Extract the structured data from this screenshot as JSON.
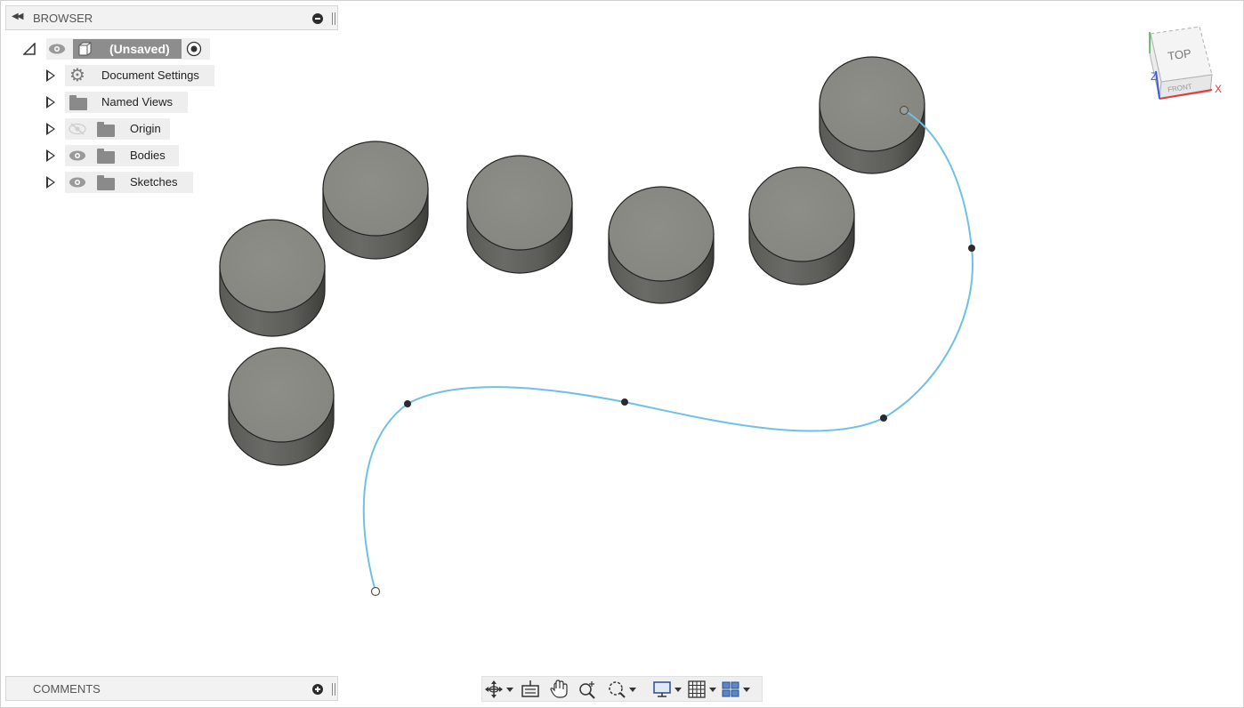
{
  "browser": {
    "title": "BROWSER",
    "root_label": "(Unsaved)",
    "items": [
      {
        "label": "Document Settings",
        "icon": "gear-icon"
      },
      {
        "label": "Named Views",
        "icon": "folder-icon"
      },
      {
        "label": "Origin",
        "icon": "folder-icon",
        "visibility": "hidden"
      },
      {
        "label": "Bodies",
        "icon": "folder-icon",
        "visibility": "visible"
      },
      {
        "label": "Sketches",
        "icon": "folder-icon",
        "visibility": "visible"
      }
    ]
  },
  "comments": {
    "title": "COMMENTS"
  },
  "viewcube": {
    "top_label": "TOP",
    "front_label": "FRONT",
    "axis_x": "X",
    "axis_z": "Z"
  },
  "toolbar": {
    "buttons": [
      "orbit-icon",
      "look-at-icon",
      "pan-icon",
      "zoom-icon",
      "fit-icon",
      "display-settings-icon",
      "grid-icon",
      "viewports-icon"
    ]
  },
  "colors": {
    "spline": "#6ec1e4",
    "body_top": "#8b8b86",
    "body_side": "#5d5d59",
    "panel_bg": "#f2f2f2",
    "chip_bg": "#eeeeee",
    "root_chip": "#8d8d8d"
  }
}
